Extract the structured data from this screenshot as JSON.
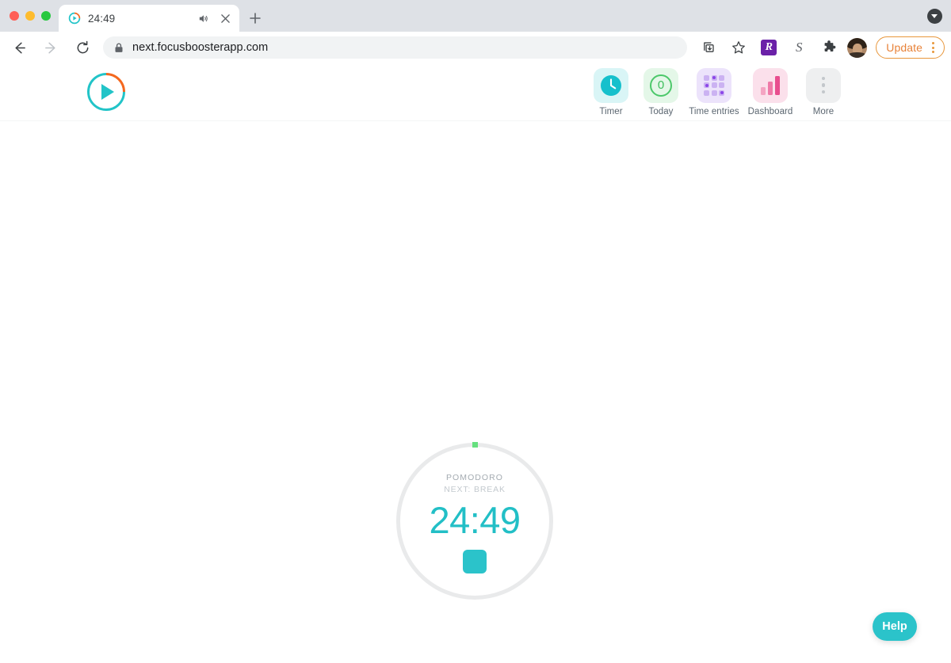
{
  "browser": {
    "traffic_lights": [
      "close",
      "minimize",
      "maximize"
    ],
    "tab": {
      "favicon": "focusbooster-logo-icon",
      "title": "24:49",
      "audio_icon": "speaker-playing-icon",
      "close_icon": "close-icon"
    },
    "newtab_icon": "plus-icon",
    "tab_search_icon": "caret-down-icon",
    "back_icon": "arrow-left-icon",
    "forward_icon": "arrow-right-icon",
    "reload_icon": "reload-icon",
    "omnibox": {
      "lock_icon": "lock-icon",
      "url": "next.focusboosterapp.com"
    },
    "toolbar_icons": [
      {
        "name": "install-page-icon",
        "glyph": "download"
      },
      {
        "name": "bookmark-star-icon",
        "glyph": "star"
      },
      {
        "name": "rakuten-extension-icon",
        "glyph": "R"
      },
      {
        "name": "grammarly-extension-icon",
        "glyph": "S"
      },
      {
        "name": "extensions-puzzle-icon",
        "glyph": "puzzle"
      },
      {
        "name": "profile-avatar",
        "glyph": "avatar"
      }
    ],
    "update_button": {
      "label": "Update",
      "menu_icon": "kebab-menu-icon",
      "accent": "#e8833a"
    }
  },
  "app": {
    "logo_name": "focusbooster-logo",
    "nav": [
      {
        "label": "Timer",
        "icon": "clock-icon",
        "tile": "tile-timer",
        "active": true
      },
      {
        "label": "Today",
        "icon": "today-count-icon",
        "tile": "tile-today",
        "count": "0",
        "active": false
      },
      {
        "label": "Time entries",
        "icon": "grid-icon",
        "tile": "tile-entries",
        "active": false
      },
      {
        "label": "Dashboard",
        "icon": "bar-chart-icon",
        "tile": "tile-dashboard",
        "active": false
      },
      {
        "label": "More",
        "icon": "kebab-menu-icon",
        "tile": "tile-more",
        "active": false
      }
    ],
    "timer": {
      "mode": "POMODORO",
      "next": "NEXT: BREAK",
      "time": "24:49",
      "stop_icon": "stop-square-icon",
      "accent": "#22bfc6",
      "progress_color": "#66e07f",
      "ring_color": "#e9eaeb"
    },
    "help_button": {
      "label": "Help",
      "color": "#2bc3ca"
    }
  }
}
